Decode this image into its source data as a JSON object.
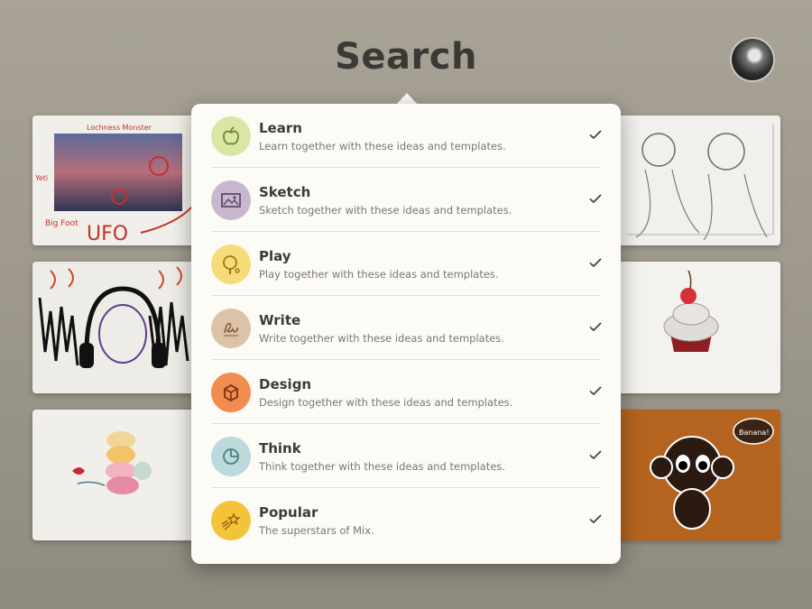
{
  "header": {
    "title": "Search"
  },
  "thumbnails_left": [
    {
      "name": "thumb-lochness",
      "texts": [
        "Lochness Monster",
        "Yeti",
        "Big Foot",
        "UFO"
      ]
    },
    {
      "name": "thumb-headphones"
    },
    {
      "name": "thumb-macarons"
    }
  ],
  "thumbnails_right": [
    {
      "name": "thumb-children-sketch"
    },
    {
      "name": "thumb-cupcake"
    },
    {
      "name": "thumb-monkey",
      "texts": [
        "Banana!"
      ]
    }
  ],
  "menu": {
    "items": [
      {
        "label": "Learn",
        "description": "Learn together with these ideas and templates.",
        "icon": "apple-icon",
        "color": "#d8e6a6",
        "icon_color": "#6e8a2c",
        "checked": true
      },
      {
        "label": "Sketch",
        "description": "Sketch together with these ideas and templates.",
        "icon": "picture-icon",
        "color": "#c9b7cc",
        "icon_color": "#5e4a66",
        "checked": true
      },
      {
        "label": "Play",
        "description": "Play together with these ideas and templates.",
        "icon": "paddle-icon",
        "color": "#f5dc78",
        "icon_color": "#a6731c",
        "checked": true
      },
      {
        "label": "Write",
        "description": "Write together with these ideas and templates.",
        "icon": "handwriting-icon",
        "color": "#dcc3a8",
        "icon_color": "#8a5a34",
        "checked": true
      },
      {
        "label": "Design",
        "description": "Design together with these ideas and templates.",
        "icon": "cube-icon",
        "color": "#f28b4e",
        "icon_color": "#7a3212",
        "checked": true
      },
      {
        "label": "Think",
        "description": "Think together with these ideas and templates.",
        "icon": "pie-chart-icon",
        "color": "#bcd9dc",
        "icon_color": "#4d7f86",
        "checked": true
      },
      {
        "label": "Popular",
        "description": "The superstars of Mix.",
        "icon": "shooting-star-icon",
        "color": "#f3c43a",
        "icon_color": "#a35a10",
        "checked": true
      }
    ]
  }
}
